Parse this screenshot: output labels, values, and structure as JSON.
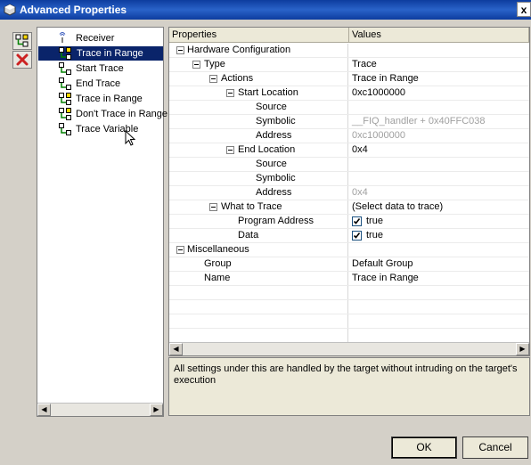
{
  "window": {
    "title": "Advanced Properties",
    "close_label": "x"
  },
  "list": {
    "items": [
      {
        "label": "Receiver",
        "icon": "receiver-icon",
        "selected": false
      },
      {
        "label": "Trace in Range",
        "icon": "trace-range-icon",
        "selected": true
      },
      {
        "label": "Start Trace",
        "icon": "trace-point-icon",
        "selected": false
      },
      {
        "label": "End Trace",
        "icon": "trace-point-icon",
        "selected": false
      },
      {
        "label": "Trace in Range",
        "icon": "trace-range-icon",
        "selected": false
      },
      {
        "label": "Don't Trace in Range",
        "icon": "trace-range-icon",
        "selected": false
      },
      {
        "label": "Trace Variable",
        "icon": "trace-point-icon",
        "selected": false
      }
    ]
  },
  "grid": {
    "headers": {
      "properties": "Properties",
      "values": "Values"
    },
    "rows": [
      {
        "label": "Hardware Configuration",
        "value": "",
        "level": 0,
        "expander": true
      },
      {
        "label": "Type",
        "value": "Trace",
        "level": 1,
        "expander": true
      },
      {
        "label": "Actions",
        "value": "Trace in Range",
        "level": 2,
        "expander": true
      },
      {
        "label": "Start Location",
        "value": "0xc1000000",
        "level": 3,
        "expander": true
      },
      {
        "label": "Source",
        "value": "",
        "level": 4
      },
      {
        "label": "Symbolic",
        "value": "__FIQ_handler + 0x40FFC038",
        "level": 4,
        "dim": true
      },
      {
        "label": "Address",
        "value": "0xc1000000",
        "level": 4,
        "dim": true
      },
      {
        "label": "End Location",
        "value": "0x4",
        "level": 3,
        "expander": true
      },
      {
        "label": "Source",
        "value": "",
        "level": 4
      },
      {
        "label": "Symbolic",
        "value": "",
        "level": 4
      },
      {
        "label": "Address",
        "value": "0x4",
        "level": 4,
        "dim": true
      },
      {
        "label": "What to Trace",
        "value": "(Select data to trace)",
        "level": 2,
        "expander": true
      },
      {
        "label": "Program Address",
        "value": "true",
        "level": 3,
        "checkbox": true,
        "checked": true
      },
      {
        "label": "Data",
        "value": "true",
        "level": 3,
        "checkbox": true,
        "checked": true
      },
      {
        "label": "Miscellaneous",
        "value": "",
        "level": 0,
        "expander": true
      },
      {
        "label": "Group",
        "value": "Default Group",
        "level": 1
      },
      {
        "label": "Name",
        "value": "Trace in Range",
        "level": 1
      },
      {
        "label": "",
        "value": "",
        "level": 0
      },
      {
        "label": "",
        "value": "",
        "level": 0
      },
      {
        "label": "",
        "value": "",
        "level": 0
      },
      {
        "label": "",
        "value": "",
        "level": 0
      }
    ]
  },
  "description": "All settings under this are handled by the target without intruding on the target's execution",
  "buttons": {
    "ok": "OK",
    "cancel": "Cancel"
  },
  "colors": {
    "title_bar": "#0d3c9e",
    "selection": "#0a246a",
    "dim_text": "#a0a0a0",
    "delete_icon": "#cc2222"
  }
}
